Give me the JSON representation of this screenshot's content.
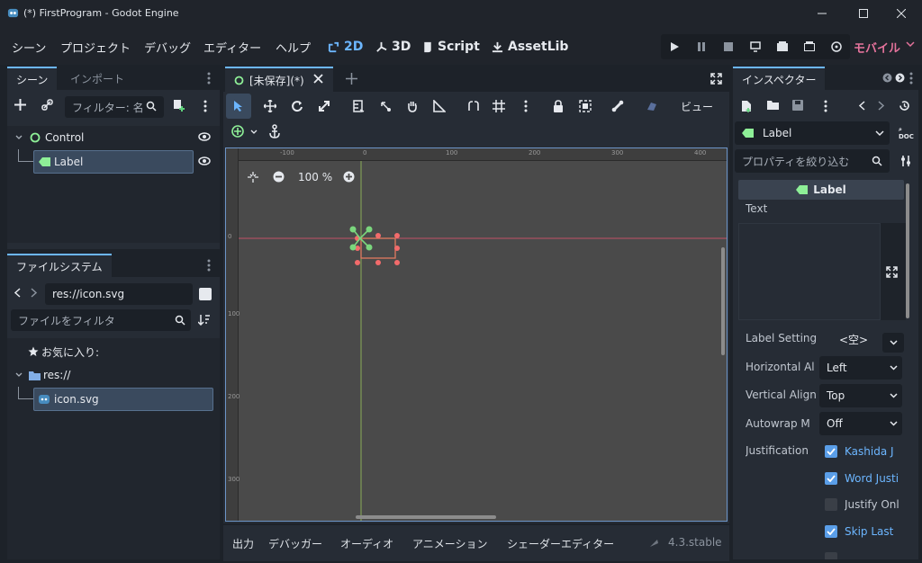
{
  "window": {
    "title": "(*) FirstProgram - Godot Engine"
  },
  "menu": {
    "items": [
      "シーン",
      "プロジェクト",
      "デバッグ",
      "エディター",
      "ヘルプ"
    ]
  },
  "workspaces": [
    {
      "label": "2D",
      "active": true
    },
    {
      "label": "3D",
      "active": false
    },
    {
      "label": "Script",
      "active": false
    },
    {
      "label": "AssetLib",
      "active": false
    }
  ],
  "renderer": "モバイル",
  "scene_dock": {
    "tabs": [
      "シーン",
      "インポート"
    ],
    "filter_placeholder": "フィルター: 名",
    "nodes": [
      {
        "label": "Control",
        "icon": "control-icon"
      },
      {
        "label": "Label",
        "icon": "label-icon"
      }
    ]
  },
  "filesystem": {
    "tab": "ファイルシステム",
    "path": "res://icon.svg",
    "filter_placeholder": "ファイルをフィルタ",
    "favorites": "お気に入り:",
    "root": "res://",
    "files": [
      "icon.svg"
    ]
  },
  "editor": {
    "scene_tab": "[未保存](*)",
    "view_menu": "ビュー",
    "zoom": "100 %",
    "ruler_h": [
      "-100",
      "0",
      "100",
      "200",
      "300",
      "400"
    ],
    "ruler_v": [
      "0",
      "100",
      "200",
      "300"
    ]
  },
  "bottom": {
    "tabs": [
      "出力",
      "デバッガー",
      "オーディオ",
      "アニメーション",
      "シェーダーエディター"
    ],
    "version": "4.3.stable"
  },
  "inspector": {
    "tab": "インスペクター",
    "node_type": "Label",
    "filter_placeholder": "プロパティを絞り込む",
    "section": "Label",
    "text_label": "Text",
    "props": [
      {
        "name": "Label Setting",
        "value": "<空>"
      },
      {
        "name": "Horizontal Al",
        "value": "Left"
      },
      {
        "name": "Vertical Align",
        "value": "Top"
      },
      {
        "name": "Autowrap M",
        "value": "Off"
      }
    ],
    "justification_label": "Justification",
    "justification": [
      {
        "label": "Kashida J",
        "checked": true
      },
      {
        "label": "Word Justi",
        "checked": true
      },
      {
        "label": "Justify Onl",
        "checked": false
      },
      {
        "label": "Skip Last",
        "checked": true
      }
    ]
  }
}
